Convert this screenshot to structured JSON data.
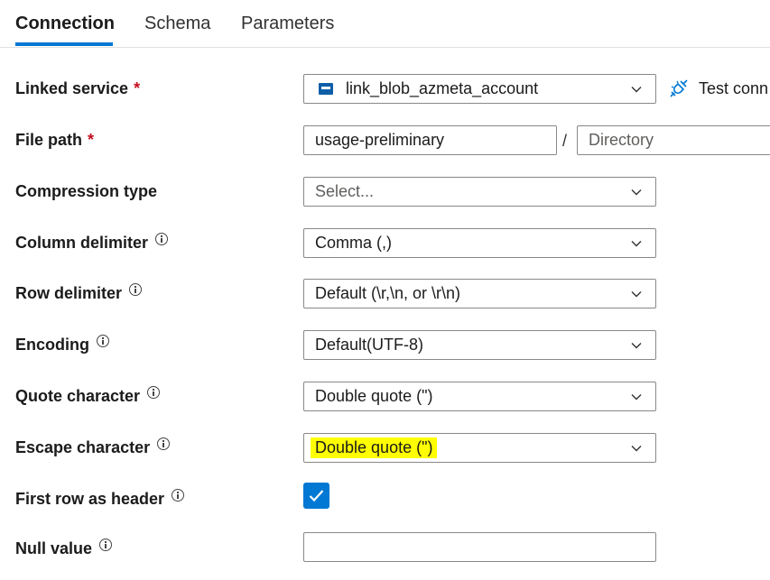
{
  "tabs": {
    "connection": "Connection",
    "schema": "Schema",
    "parameters": "Parameters"
  },
  "linked_service": {
    "label": "Linked service",
    "required": "*",
    "value": "link_blob_azmeta_account",
    "icon": "storage-account-icon",
    "test_connection": "Test conn"
  },
  "file_path": {
    "label": "File path",
    "required": "*",
    "container_value": "usage-preliminary",
    "separator": "/",
    "directory_placeholder": "Directory"
  },
  "compression_type": {
    "label": "Compression type",
    "placeholder": "Select..."
  },
  "column_delimiter": {
    "label": "Column delimiter",
    "value": "Comma (,)"
  },
  "row_delimiter": {
    "label": "Row delimiter",
    "value": "Default (\\r,\\n, or \\r\\n)"
  },
  "encoding": {
    "label": "Encoding",
    "value": "Default(UTF-8)"
  },
  "quote_character": {
    "label": "Quote character",
    "value": "Double quote (\")"
  },
  "escape_character": {
    "label": "Escape character",
    "value": "Double quote (\")",
    "highlight_color": "#ffff00"
  },
  "first_row_header": {
    "label": "First row as header",
    "checked": true
  },
  "null_value": {
    "label": "Null value",
    "value": ""
  },
  "colors": {
    "accent": "#0078d4",
    "required": "#c50f1f",
    "border": "#8a8886"
  }
}
